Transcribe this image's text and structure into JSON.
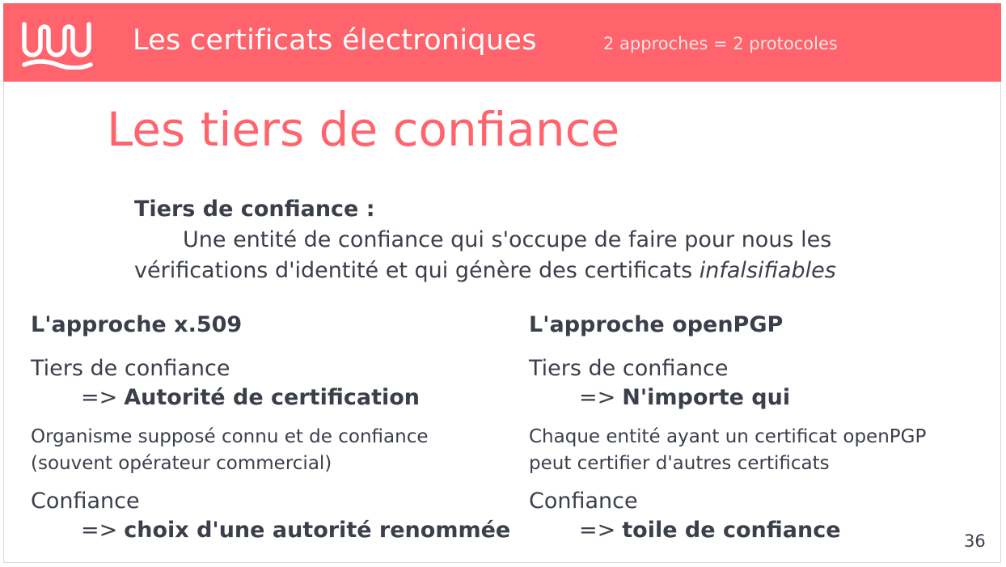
{
  "header": {
    "title": "Les certificats électroniques",
    "subtitle": "2 approches = 2 protocoles",
    "logo_icon": "wavy-loops-logo-icon",
    "background_color": "#ff636b"
  },
  "page_title": "Les tiers de confiance",
  "definition": {
    "term": "Tiers de confiance :",
    "text_line1": "Une entité de confiance qui s'occupe de faire pour nous les",
    "text_line2": "vérifications d'identité et qui génère des certificats ",
    "text_emphasis": "infalsifiables"
  },
  "left_column": {
    "heading": "L'approche x.509",
    "trust_label": "Tiers de confiance",
    "trust_arrow": "=>",
    "trust_value": "Autorité de certification",
    "description_line1": "Organisme supposé connu et de confiance",
    "description_line2": "(souvent opérateur commercial)",
    "confidence_label": "Confiance",
    "confidence_arrow": "=>",
    "confidence_value": "choix d'une autorité renommée"
  },
  "right_column": {
    "heading": "L'approche openPGP",
    "trust_label": "Tiers de confiance",
    "trust_arrow": "=>",
    "trust_value": "N'importe qui",
    "description_line1": "Chaque entité ayant un certificat openPGP",
    "description_line2": "peut certifier d'autres certificats",
    "confidence_label": "Confiance",
    "confidence_arrow": "=>",
    "confidence_value": "toile de confiance"
  },
  "page_number": "36",
  "colors": {
    "accent": "#ff636b",
    "text": "#3a3f4a"
  }
}
